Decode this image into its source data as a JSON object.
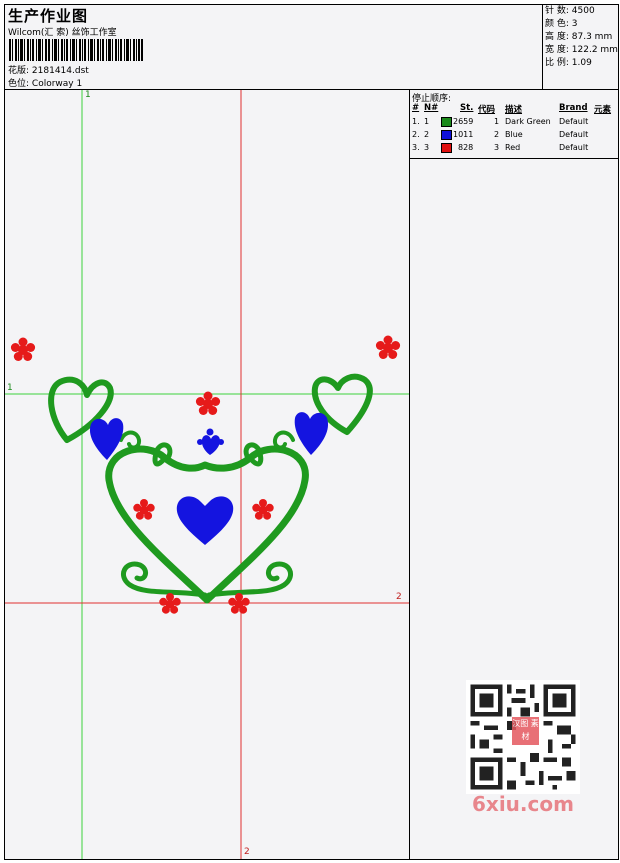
{
  "header": {
    "title": "生产作业图",
    "studio": "Wilcom(汇 索) 丝饰工作室",
    "design_label": "花版:",
    "design_value": "2181414.dst",
    "colorway_label": "色位:",
    "colorway_value": "Colorway 1"
  },
  "specs": [
    {
      "label": "针 数:",
      "value": "4500"
    },
    {
      "label": "颜 色:",
      "value": "3"
    },
    {
      "label": "高 度:",
      "value": "87.3 mm"
    },
    {
      "label": "宽 度:",
      "value": "122.2 mm"
    },
    {
      "label": "比 例:",
      "value": "1.09"
    }
  ],
  "stop_sequence": {
    "title": "停止顺序:",
    "columns": [
      "#",
      "N#",
      "St.",
      "代码",
      "描述",
      "Brand",
      "元素"
    ],
    "rows": [
      {
        "num": "1.",
        "needle": "1",
        "color": "#1a8a1a",
        "stitches": "2659",
        "code": "1",
        "desc": "Dark Green",
        "brand": "Default"
      },
      {
        "num": "2.",
        "needle": "2",
        "color": "#1010d8",
        "stitches": "1011",
        "code": "2",
        "desc": "Blue",
        "brand": "Default"
      },
      {
        "num": "3.",
        "needle": "3",
        "color": "#e01010",
        "stitches": "828",
        "code": "3",
        "desc": "Red",
        "brand": "Default"
      }
    ]
  },
  "guides": {
    "h1_label": "1",
    "v1_label": "1",
    "h2_label": "2",
    "v2_label": "2"
  },
  "watermark": {
    "site": "6xiu.com",
    "stamp": "汉图 素材"
  },
  "colors": {
    "green": "#1f9a1f",
    "blue": "#1414e0",
    "red": "#e61a1a",
    "guide_green": "#3cd23c",
    "guide_red": "#e03030"
  }
}
